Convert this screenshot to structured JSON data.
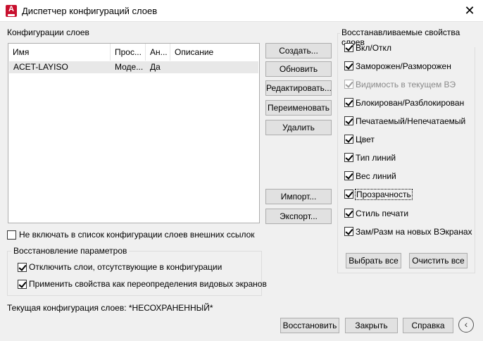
{
  "window": {
    "title": "Диспетчер конфигураций слоев",
    "app_icon_letter": "A",
    "close_glyph": "✕"
  },
  "configs": {
    "label": "Конфигурации слоев",
    "columns": [
      "Имя",
      "Прос...",
      "Ан...",
      "Описание"
    ],
    "rows": [
      {
        "name": "ACET-LAYISO",
        "space": "Моде...",
        "annot": "Да",
        "desc": ""
      }
    ]
  },
  "buttons": {
    "create": "Создать...",
    "update": "Обновить",
    "edit": "Редактировать...",
    "rename": "Переименовать",
    "delete": "Удалить",
    "import": "Импорт...",
    "export": "Экспорт..."
  },
  "exclude_xref": {
    "label": "Не включать в список конфигурации слоев внешних ссылок",
    "checked": false
  },
  "restore_options": {
    "label": "Восстановление параметров",
    "turn_off": {
      "label": "Отключить слои, отсутствующие в конфигурации",
      "checked": true
    },
    "apply_overrides": {
      "label": "Применить свойства как переопределения видовых экранов",
      "checked": true
    }
  },
  "properties": {
    "label": "Восстанавливаемые свойства слоев",
    "items": [
      {
        "label": "Вкл/Откл",
        "checked": true,
        "disabled": false
      },
      {
        "label": "Заморожен/Разморожен",
        "checked": true,
        "disabled": false
      },
      {
        "label": "Видимость в текущем ВЭ",
        "checked": true,
        "disabled": true
      },
      {
        "label": "Блокирован/Разблокирован",
        "checked": true,
        "disabled": false
      },
      {
        "label": "Печатаемый/Непечатаемый",
        "checked": true,
        "disabled": false
      },
      {
        "label": "Цвет",
        "checked": true,
        "disabled": false
      },
      {
        "label": "Тип линий",
        "checked": true,
        "disabled": false
      },
      {
        "label": "Вес линий",
        "checked": true,
        "disabled": false
      },
      {
        "label": "Прозрачность",
        "checked": true,
        "disabled": false
      },
      {
        "label": "Стиль печати",
        "checked": true,
        "disabled": false
      },
      {
        "label": "Зам/Разм на новых ВЭкранах",
        "checked": true,
        "disabled": false
      }
    ],
    "select_all": "Выбрать все",
    "clear_all": "Очистить все"
  },
  "status": {
    "current_config": "Текущая конфигурация слоев: *НЕСОХРАНЕННЫЙ*"
  },
  "footer": {
    "restore": "Восстановить",
    "close": "Закрыть",
    "help": "Справка",
    "back_glyph": "‹"
  }
}
